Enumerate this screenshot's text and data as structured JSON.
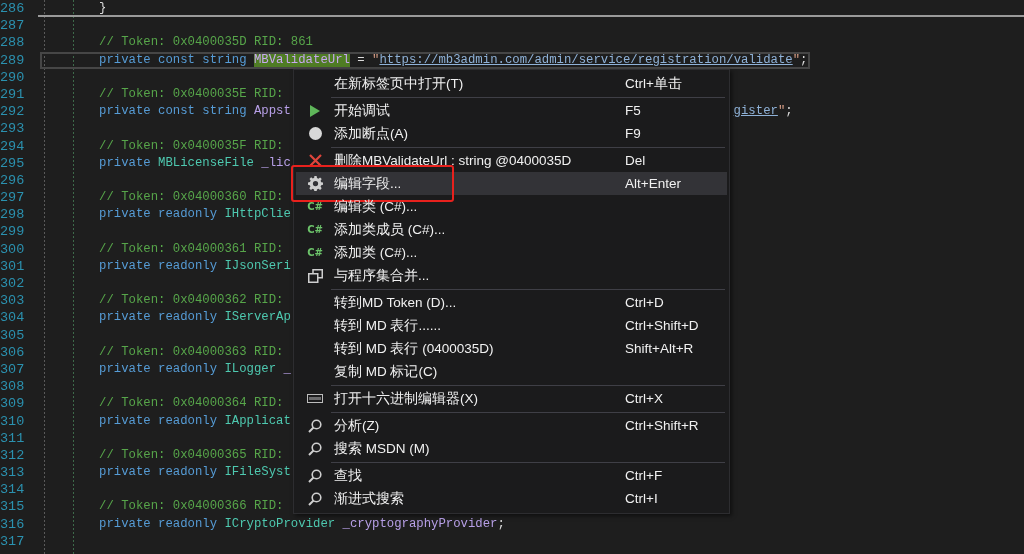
{
  "editor": {
    "lines": [
      {
        "number": "286",
        "divider": true,
        "current": false,
        "tokens": [
          {
            "kind": "plain",
            "text": "}"
          }
        ]
      },
      {
        "number": "287",
        "divider": false,
        "current": false
      },
      {
        "number": "288",
        "divider": false,
        "current": false,
        "tokens": [
          {
            "kind": "comment",
            "text": "// Token: 0x0400035D RID: 861"
          }
        ]
      },
      {
        "number": "289",
        "divider": false,
        "current": true,
        "tokens": [
          {
            "kind": "keyword",
            "text": "private const string "
          },
          {
            "kind": "match",
            "text": "MBValidateUrl"
          },
          {
            "kind": "plain",
            "text": " = "
          },
          {
            "kind": "quote",
            "text": "\""
          },
          {
            "kind": "url",
            "text": "https://mb3admin.com/admin/service/registration/validate"
          },
          {
            "kind": "quote",
            "text": "\""
          },
          {
            "kind": "plain",
            "text": ";"
          }
        ]
      },
      {
        "number": "290",
        "divider": false,
        "current": false
      },
      {
        "number": "291",
        "divider": false,
        "current": false,
        "tokens": [
          {
            "kind": "comment",
            "text": "// Token: 0x0400035E RID: "
          }
        ]
      },
      {
        "number": "292",
        "divider": false,
        "current": false,
        "tokens": [
          {
            "kind": "keyword",
            "text": "private const string "
          },
          {
            "kind": "name",
            "text": "Appst"
          }
        ],
        "tail": [
          {
            "kind": "url",
            "text": "gister"
          },
          {
            "kind": "quote",
            "text": "\""
          },
          {
            "kind": "plain",
            "text": ";"
          }
        ]
      },
      {
        "number": "293",
        "divider": false,
        "current": false
      },
      {
        "number": "294",
        "divider": false,
        "current": false,
        "tokens": [
          {
            "kind": "comment",
            "text": "// Token: 0x0400035F RID: "
          }
        ]
      },
      {
        "number": "295",
        "divider": false,
        "current": false,
        "tokens": [
          {
            "kind": "keyword",
            "text": "private "
          },
          {
            "kind": "type",
            "text": "MBLicenseFile "
          },
          {
            "kind": "name",
            "text": "_lic"
          }
        ]
      },
      {
        "number": "296",
        "divider": false,
        "current": false
      },
      {
        "number": "297",
        "divider": false,
        "current": false,
        "tokens": [
          {
            "kind": "comment",
            "text": "// Token: 0x04000360 RID: "
          }
        ]
      },
      {
        "number": "298",
        "divider": false,
        "current": false,
        "tokens": [
          {
            "kind": "keyword",
            "text": "private readonly "
          },
          {
            "kind": "type",
            "text": "IHttpClie"
          }
        ]
      },
      {
        "number": "299",
        "divider": false,
        "current": false
      },
      {
        "number": "300",
        "divider": false,
        "current": false,
        "tokens": [
          {
            "kind": "comment",
            "text": "// Token: 0x04000361 RID: "
          }
        ]
      },
      {
        "number": "301",
        "divider": false,
        "current": false,
        "tokens": [
          {
            "kind": "keyword",
            "text": "private readonly "
          },
          {
            "kind": "type",
            "text": "IJsonSeri"
          }
        ]
      },
      {
        "number": "302",
        "divider": false,
        "current": false
      },
      {
        "number": "303",
        "divider": false,
        "current": false,
        "tokens": [
          {
            "kind": "comment",
            "text": "// Token: 0x04000362 RID: "
          }
        ]
      },
      {
        "number": "304",
        "divider": false,
        "current": false,
        "tokens": [
          {
            "kind": "keyword",
            "text": "private readonly "
          },
          {
            "kind": "type",
            "text": "IServerAp"
          }
        ]
      },
      {
        "number": "305",
        "divider": false,
        "current": false
      },
      {
        "number": "306",
        "divider": false,
        "current": false,
        "tokens": [
          {
            "kind": "comment",
            "text": "// Token: 0x04000363 RID: "
          }
        ]
      },
      {
        "number": "307",
        "divider": false,
        "current": false,
        "tokens": [
          {
            "kind": "keyword",
            "text": "private readonly "
          },
          {
            "kind": "type",
            "text": "ILogger "
          },
          {
            "kind": "name",
            "text": "_"
          }
        ]
      },
      {
        "number": "308",
        "divider": false,
        "current": false
      },
      {
        "number": "309",
        "divider": false,
        "current": false,
        "tokens": [
          {
            "kind": "comment",
            "text": "// Token: 0x04000364 RID: "
          }
        ]
      },
      {
        "number": "310",
        "divider": false,
        "current": false,
        "tokens": [
          {
            "kind": "keyword",
            "text": "private readonly "
          },
          {
            "kind": "type",
            "text": "IApplicat"
          }
        ]
      },
      {
        "number": "311",
        "divider": false,
        "current": false
      },
      {
        "number": "312",
        "divider": false,
        "current": false,
        "tokens": [
          {
            "kind": "comment",
            "text": "// Token: 0x04000365 RID: "
          }
        ]
      },
      {
        "number": "313",
        "divider": false,
        "current": false,
        "tokens": [
          {
            "kind": "keyword",
            "text": "private readonly "
          },
          {
            "kind": "type",
            "text": "IFileSyst"
          }
        ]
      },
      {
        "number": "314",
        "divider": false,
        "current": false
      },
      {
        "number": "315",
        "divider": false,
        "current": false,
        "tokens": [
          {
            "kind": "comment",
            "text": "// Token: 0x04000366 RID: "
          }
        ]
      },
      {
        "number": "316",
        "divider": false,
        "current": false,
        "tokens": [
          {
            "kind": "keyword",
            "text": "private readonly "
          },
          {
            "kind": "type",
            "text": "ICryptoProvider "
          },
          {
            "kind": "name",
            "text": "_cryptographyProvider"
          },
          {
            "kind": "plain",
            "text": ";"
          }
        ]
      },
      {
        "number": "317",
        "divider": false,
        "current": false
      }
    ]
  },
  "context_menu": {
    "items": [
      {
        "kind": "plain",
        "label": "在新标签页中打开(T)",
        "shortcut": "Ctrl+单击",
        "selected": false,
        "framed": false
      },
      {
        "kind": "separator"
      },
      {
        "kind": "play",
        "label": "开始调试",
        "shortcut": "F5",
        "selected": false,
        "framed": false
      },
      {
        "kind": "dot",
        "label": "添加断点(A)",
        "shortcut": "F9",
        "selected": false,
        "framed": false
      },
      {
        "kind": "separator"
      },
      {
        "kind": "cross",
        "label": "删除MBValidateUrl : string @0400035D",
        "shortcut": "Del",
        "selected": false,
        "framed": false
      },
      {
        "kind": "gear",
        "label": "编辑字段...",
        "shortcut": "Alt+Enter",
        "selected": true,
        "framed": true
      },
      {
        "kind": "csharp",
        "icon_text": "C#",
        "label": "编辑类 (C#)...",
        "selected": false,
        "framed": false
      },
      {
        "kind": "csharp",
        "icon_text": "C#",
        "label": "添加类成员 (C#)...",
        "selected": false,
        "framed": false
      },
      {
        "kind": "csharp",
        "icon_text": "C#",
        "label": "添加类 (C#)...",
        "selected": false,
        "framed": false
      },
      {
        "kind": "windows",
        "label": "与程序集合并...",
        "selected": false,
        "framed": false
      },
      {
        "kind": "separator"
      },
      {
        "kind": "plain",
        "label": "转到MD Token (D)...",
        "shortcut": "Ctrl+D",
        "selected": false,
        "framed": false
      },
      {
        "kind": "plain",
        "label": "转到 MD 表行......",
        "shortcut": "Ctrl+Shift+D",
        "selected": false,
        "framed": false
      },
      {
        "kind": "plain",
        "label": "转到 MD 表行 (0400035D)",
        "shortcut": "Shift+Alt+R",
        "selected": false,
        "framed": false
      },
      {
        "kind": "plain",
        "label": "复制 MD 标记(C)",
        "selected": false,
        "framed": false
      },
      {
        "kind": "separator"
      },
      {
        "kind": "hex",
        "label": "打开十六进制编辑器(X)",
        "shortcut": "Ctrl+X",
        "selected": false,
        "framed": false
      },
      {
        "kind": "separator"
      },
      {
        "kind": "search",
        "label": "分析(Z)",
        "shortcut": "Ctrl+Shift+R",
        "selected": false,
        "framed": false
      },
      {
        "kind": "search",
        "label": "搜索 MSDN (M)",
        "selected": false,
        "framed": false
      },
      {
        "kind": "separator"
      },
      {
        "kind": "search",
        "label": "查找",
        "shortcut": "Ctrl+F",
        "selected": false,
        "framed": false
      },
      {
        "kind": "search",
        "label": "渐进式搜索",
        "shortcut": "Ctrl+I",
        "selected": false,
        "framed": false
      }
    ]
  }
}
